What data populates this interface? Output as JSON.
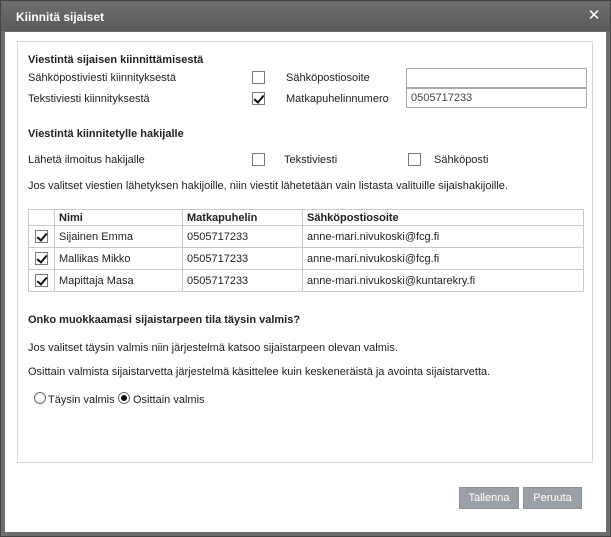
{
  "window": {
    "title": "Kiinnitä sijaiset",
    "close_glyph": "✕"
  },
  "section_substitute": {
    "heading": "Viestintä sijaisen kiinnittämisestä",
    "email_label": "Sähköpostiviesti kiinnityksestä",
    "email_checked": false,
    "sms_label": "Tekstiviesti kiinnityksestä",
    "sms_checked": true,
    "email_address_label": "Sähköpostiosoite",
    "email_address_value": "",
    "phone_label": "Matkapuhelinnumero",
    "phone_value": "0505717233"
  },
  "section_applicant": {
    "heading": "Viestintä kiinnitetylle hakijalle",
    "notify_label": "Lähetä ilmoitus hakijalle",
    "sms_label": "Tekstiviesti",
    "sms_checked": false,
    "email_label": "Sähköposti",
    "email_checked": false,
    "info_text": "Jos valitset viestien lähetyksen hakijoille, niin viestit lähetetään vain listasta valituille sijaishakijoille."
  },
  "table": {
    "columns": [
      "",
      "Nimi",
      "Matkapuhelin",
      "Sähköpostiosoite"
    ],
    "rows": [
      {
        "checked": true,
        "name": "Sijainen Emma",
        "phone": "0505717233",
        "email": "anne-mari.nivukoski@fcg.fi"
      },
      {
        "checked": true,
        "name": "Mallikas Mikko",
        "phone": "0505717233",
        "email": "anne-mari.nivukoski@fcg.fi"
      },
      {
        "checked": true,
        "name": "Mapittaja Masa",
        "phone": "0505717233",
        "email": "anne-mari.nivukoski@kuntarekry.fi"
      }
    ]
  },
  "section_status": {
    "heading": "Onko muokkaamasi sijaistarpeen tila täysin valmis?",
    "text1": "Jos valitset täysin valmis niin järjestelmä katsoo sijaistarpeen olevan valmis.",
    "text2": "Osittain valmista sijaistarvetta järjestelmä käsittelee kuin keskeneräistä ja avointa sijaistarvetta.",
    "option_full": "Täysin valmis",
    "option_partial": "Osittain valmis",
    "selected": "partial"
  },
  "buttons": {
    "save": "Tallenna",
    "cancel": "Peruuta"
  }
}
